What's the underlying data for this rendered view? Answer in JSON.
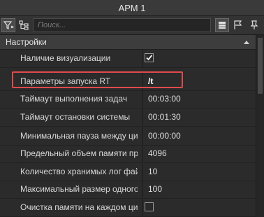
{
  "window": {
    "title": "АРМ 1"
  },
  "toolbar": {
    "search_placeholder": "Поиск...",
    "icons": [
      "filter-icon",
      "tree-icon",
      "list-view-icon",
      "flag-icon",
      "pin-icon"
    ]
  },
  "section": {
    "title": "Настройки"
  },
  "properties": [
    {
      "label": "Наличие визуализации",
      "type": "checkbox",
      "checked": true,
      "value": ""
    },
    {
      "label": "Параметры запуска RT",
      "type": "text",
      "value": "/t",
      "bold": true
    },
    {
      "label": "Таймаут выполнения задач",
      "type": "text",
      "value": "00:03:00"
    },
    {
      "label": "Таймаут остановки системы",
      "type": "text",
      "value": "00:01:30"
    },
    {
      "label": "Минимальная пауза между ци...",
      "type": "text",
      "value": "00:00:00"
    },
    {
      "label": "Предельный объем памяти пр...",
      "type": "text",
      "value": "4096"
    },
    {
      "label": "Количество хранимых лог фай...",
      "type": "text",
      "value": "10"
    },
    {
      "label": "Максимальный размер одного...",
      "type": "text",
      "value": "100"
    },
    {
      "label": "Очистка памяти на каждом ци...",
      "type": "checkbox",
      "checked": false,
      "value": ""
    }
  ],
  "colors": {
    "highlight": "#e04a4a",
    "background": "#2b2b2b"
  }
}
